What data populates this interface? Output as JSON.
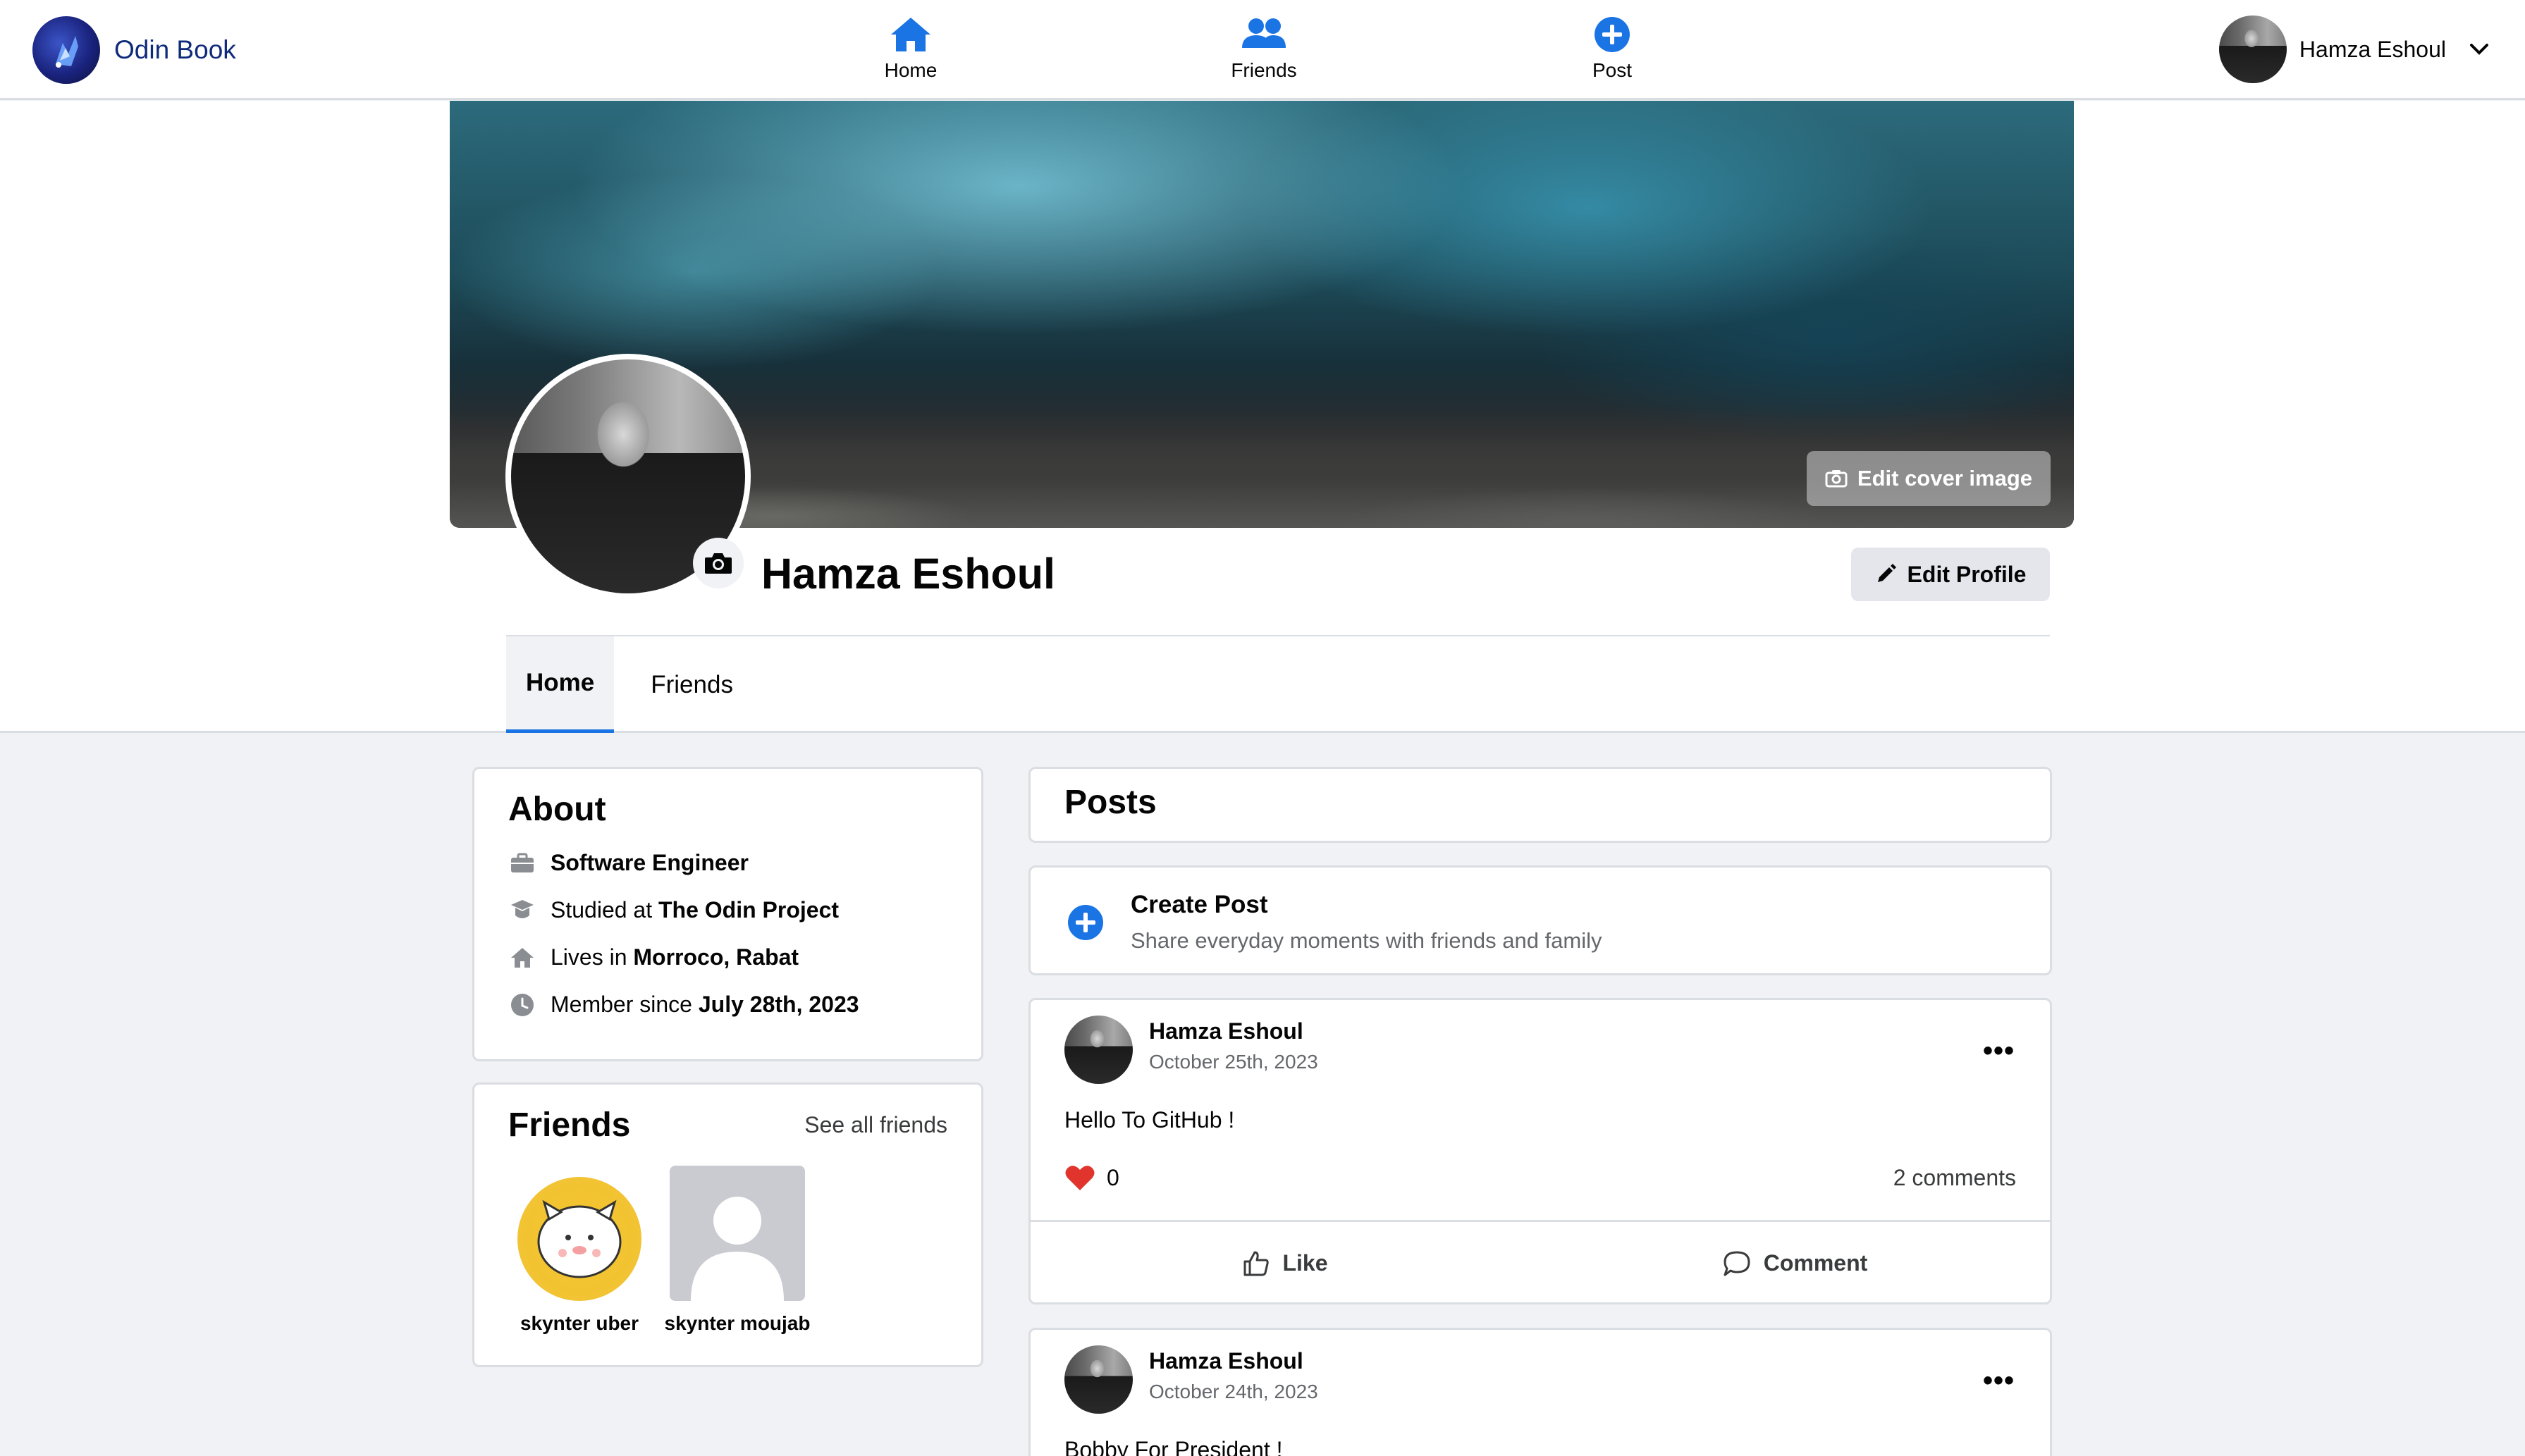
{
  "app": {
    "name": "Odin Book",
    "colors": {
      "accent": "#1b74e4",
      "heart": "#e0342c",
      "page_bg": "#f0f2f5"
    }
  },
  "nav": {
    "items": [
      {
        "label": "Home",
        "icon": "home-icon"
      },
      {
        "label": "Friends",
        "icon": "friends-icon"
      },
      {
        "label": "Post",
        "icon": "plus-circle-icon"
      }
    ],
    "user": {
      "name": "Hamza Eshoul",
      "icon": "chevron-down-icon"
    }
  },
  "profile": {
    "name": "Hamza Eshoul",
    "edit_cover_label": "Edit cover image",
    "edit_profile_label": "Edit Profile",
    "tabs": [
      "Home",
      "Friends"
    ],
    "active_tab": "Home"
  },
  "about": {
    "title": "About",
    "job": "Software Engineer",
    "studied_prefix": "Studied at",
    "studied_value": "The Odin Project",
    "lives_prefix": "Lives in",
    "lives_value": "Morroco, Rabat",
    "member_prefix": "Member since",
    "member_value": "July 28th, 2023"
  },
  "friends": {
    "title": "Friends",
    "see_all_label": "See all friends",
    "list": [
      {
        "name": "skynter uber"
      },
      {
        "name": "skynter moujab"
      }
    ]
  },
  "posts": {
    "title": "Posts",
    "create": {
      "title": "Create Post",
      "subtitle": "Share everyday moments with friends and family"
    },
    "items": [
      {
        "author": "Hamza Eshoul",
        "date": "October 25th, 2023",
        "text": "Hello To GitHub !",
        "likes": "0",
        "comments": "2 comments",
        "like_label": "Like",
        "comment_label": "Comment"
      },
      {
        "author": "Hamza Eshoul",
        "date": "October 24th, 2023",
        "text": "Bobby For President !"
      }
    ]
  }
}
